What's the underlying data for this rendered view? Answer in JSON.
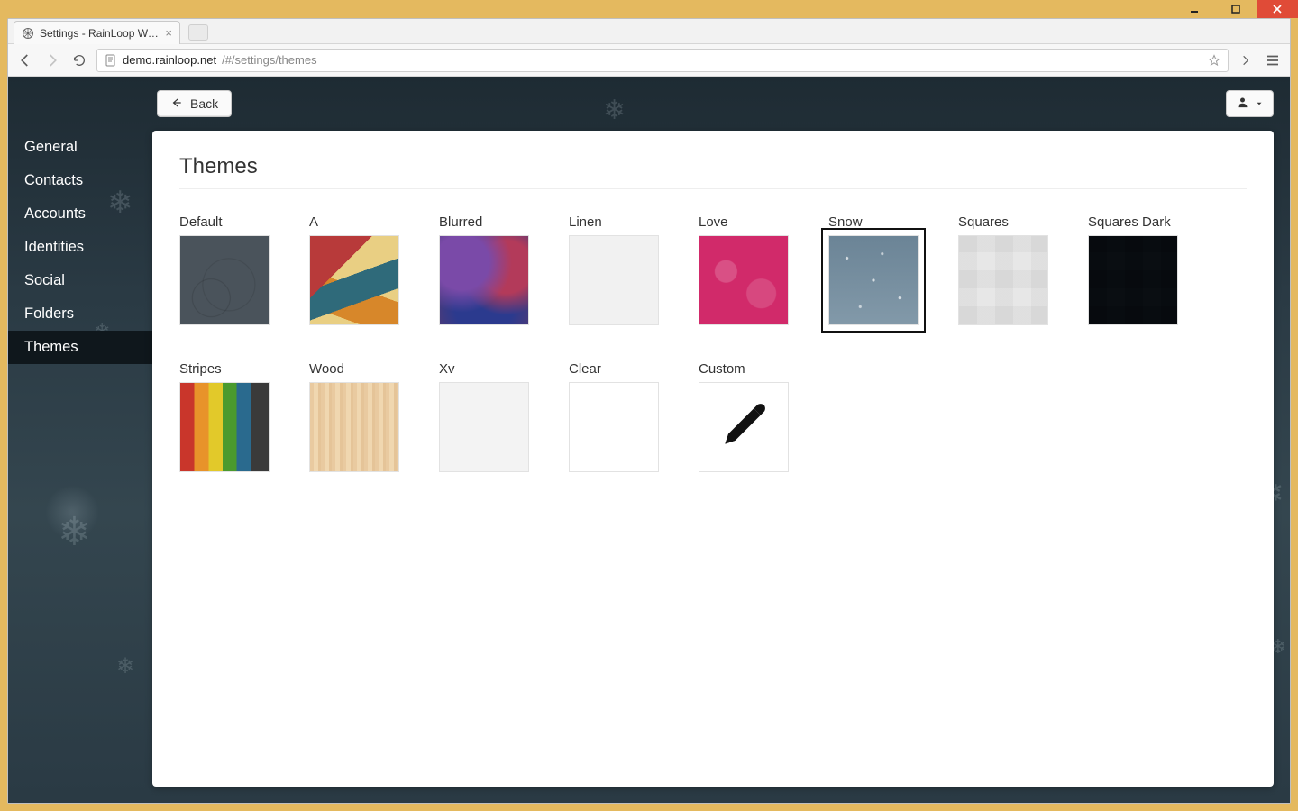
{
  "browser": {
    "tab_title": "Settings - RainLoop Webm",
    "url_host": "demo.rainloop.net",
    "url_path": "/#/settings/themes"
  },
  "topbar": {
    "back_label": "Back"
  },
  "sidebar": {
    "items": [
      {
        "label": "General",
        "active": false
      },
      {
        "label": "Contacts",
        "active": false
      },
      {
        "label": "Accounts",
        "active": false
      },
      {
        "label": "Identities",
        "active": false
      },
      {
        "label": "Social",
        "active": false
      },
      {
        "label": "Folders",
        "active": false
      },
      {
        "label": "Themes",
        "active": true
      }
    ]
  },
  "panel": {
    "heading": "Themes"
  },
  "themes": [
    {
      "label": "Default",
      "klass": "t-default",
      "selected": false
    },
    {
      "label": "A",
      "klass": "t-a",
      "selected": false
    },
    {
      "label": "Blurred",
      "klass": "t-blurred",
      "selected": false
    },
    {
      "label": "Linen",
      "klass": "t-linen",
      "selected": false
    },
    {
      "label": "Love",
      "klass": "t-love",
      "selected": false
    },
    {
      "label": "Snow",
      "klass": "t-snow",
      "selected": true
    },
    {
      "label": "Squares",
      "klass": "t-squares",
      "selected": false
    },
    {
      "label": "Squares Dark",
      "klass": "t-squaresdark",
      "selected": false
    },
    {
      "label": "Stripes",
      "klass": "t-stripes",
      "selected": false
    },
    {
      "label": "Wood",
      "klass": "t-wood",
      "selected": false
    },
    {
      "label": "Xv",
      "klass": "t-xv",
      "selected": false
    },
    {
      "label": "Clear",
      "klass": "t-clear",
      "selected": false
    },
    {
      "label": "Custom",
      "klass": "t-custom",
      "selected": false,
      "custom": true
    }
  ]
}
